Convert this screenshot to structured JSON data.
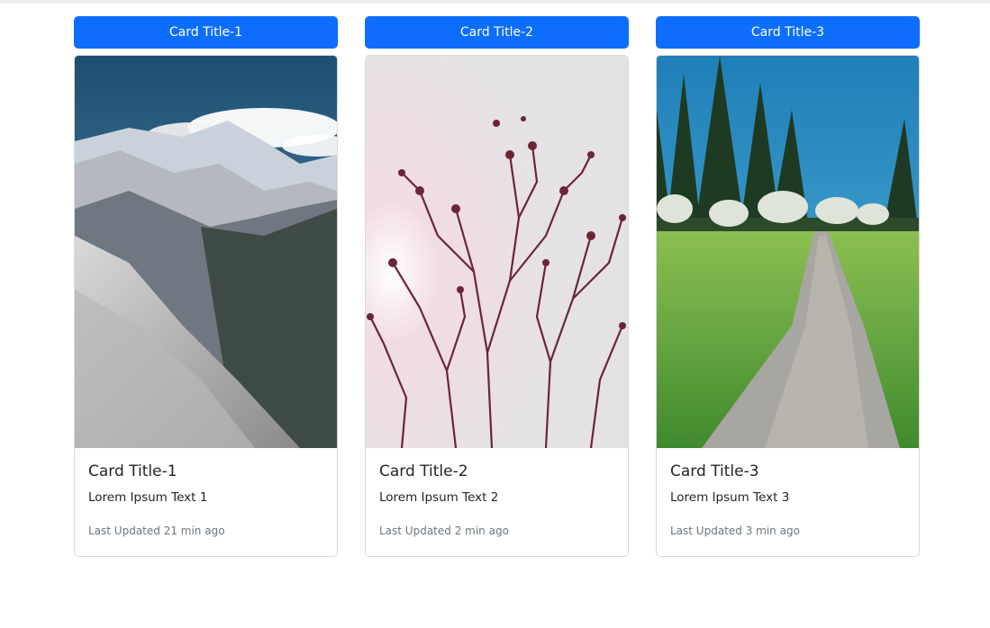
{
  "cards": [
    {
      "button_label": "Card Title-1",
      "image_subject": "snowy mountain valley",
      "title": "Card Title-1",
      "text": "Lorem Ipsum Text 1",
      "updated": "Last Updated 21 min ago"
    },
    {
      "button_label": "Card Title-2",
      "image_subject": "branches silhouette against sky",
      "title": "Card Title-2",
      "text": "Lorem Ipsum Text 2",
      "updated": "Last Updated 2 min ago"
    },
    {
      "button_label": "Card Title-3",
      "image_subject": "gravel path through green meadow with trees",
      "title": "Card Title-3",
      "text": "Lorem Ipsum Text 3",
      "updated": "Last Updated 3 min ago"
    }
  ],
  "colors": {
    "button_bg": "#0d6efd",
    "button_text": "#ffffff",
    "card_border": "#d9d9d9",
    "muted_text": "#6c757d"
  }
}
